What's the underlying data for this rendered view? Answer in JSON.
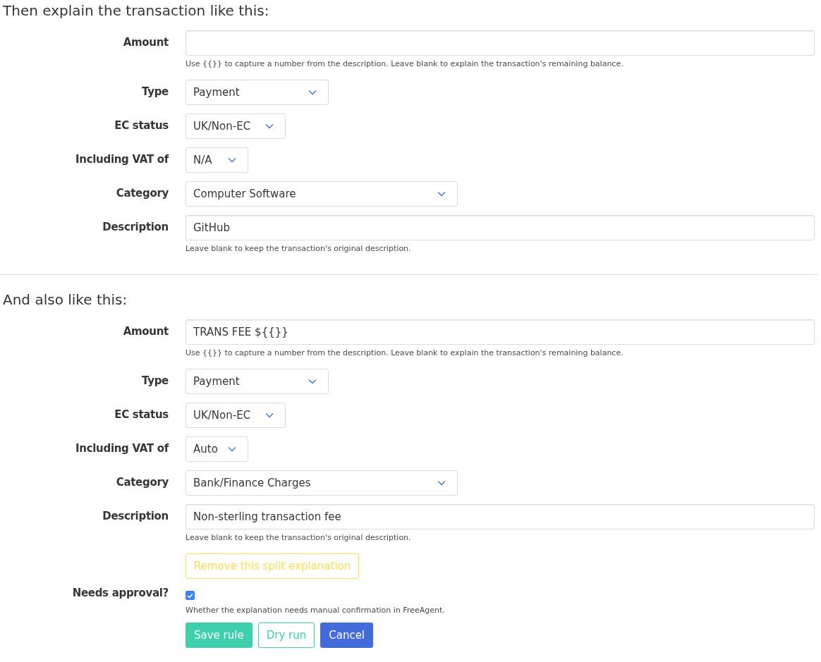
{
  "sections": [
    {
      "heading": "Then explain the transaction like this:",
      "fields": [
        {
          "label": "Amount",
          "kind": "text",
          "help": "Use {{}} to capture a number from the description. Leave blank to explain the transaction's remaining balance."
        },
        {
          "label": "Type",
          "kind": "select",
          "value": "Payment"
        },
        {
          "label": "EC status",
          "kind": "select",
          "value": "UK/Non-EC"
        },
        {
          "label": "Including VAT of",
          "kind": "select",
          "value": "N/A"
        },
        {
          "label": "Category",
          "kind": "select",
          "value": "Computer Software"
        },
        {
          "label": "Description",
          "kind": "text",
          "value": "GitHub",
          "help": "Leave blank to keep the transaction's original description."
        }
      ]
    },
    {
      "heading": "And also like this:",
      "remove_button": "Remove this split explanation",
      "fields": [
        {
          "label": "Amount",
          "kind": "text",
          "value": "TRANS FEE ${{}}",
          "help": "Use {{}} to capture a number from the description. Leave blank to explain the transaction's remaining balance."
        },
        {
          "label": "Type",
          "kind": "select",
          "value": "Payment"
        },
        {
          "label": "EC status",
          "kind": "select",
          "value": "UK/Non-EC"
        },
        {
          "label": "Including VAT of",
          "kind": "select",
          "value": "Auto"
        },
        {
          "label": "Category",
          "kind": "select",
          "value": "Bank/Finance Charges"
        },
        {
          "label": "Description",
          "kind": "text",
          "value": "Non-sterling transaction fee",
          "help": "Leave blank to keep the transaction's original description."
        }
      ]
    }
  ],
  "approval": {
    "label": "Needs approval?",
    "checked": true,
    "help": "Whether the explanation needs manual confirmation in FreeAgent."
  },
  "buttons": [
    {
      "label": "Save rule",
      "kind": "primary"
    },
    {
      "label": "Dry run",
      "kind": "outline"
    },
    {
      "label": "Cancel",
      "kind": "cancel"
    }
  ]
}
